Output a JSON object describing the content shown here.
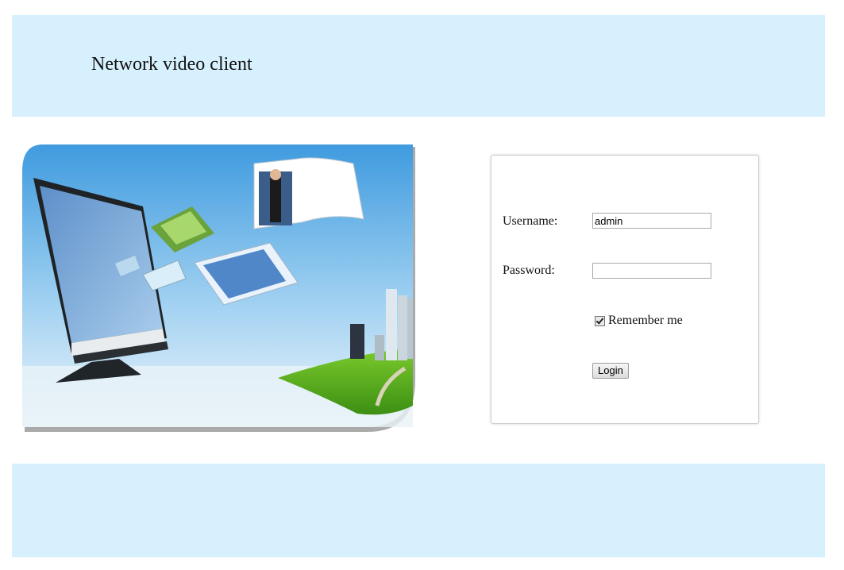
{
  "header": {
    "title": "Network video client"
  },
  "login": {
    "username_label": "Username:",
    "username_value": "admin",
    "password_label": "Password:",
    "password_value": "",
    "remember_label": "Remember me",
    "remember_checked": true,
    "login_button": "Login"
  },
  "colors": {
    "band": "#d6f1fd"
  }
}
